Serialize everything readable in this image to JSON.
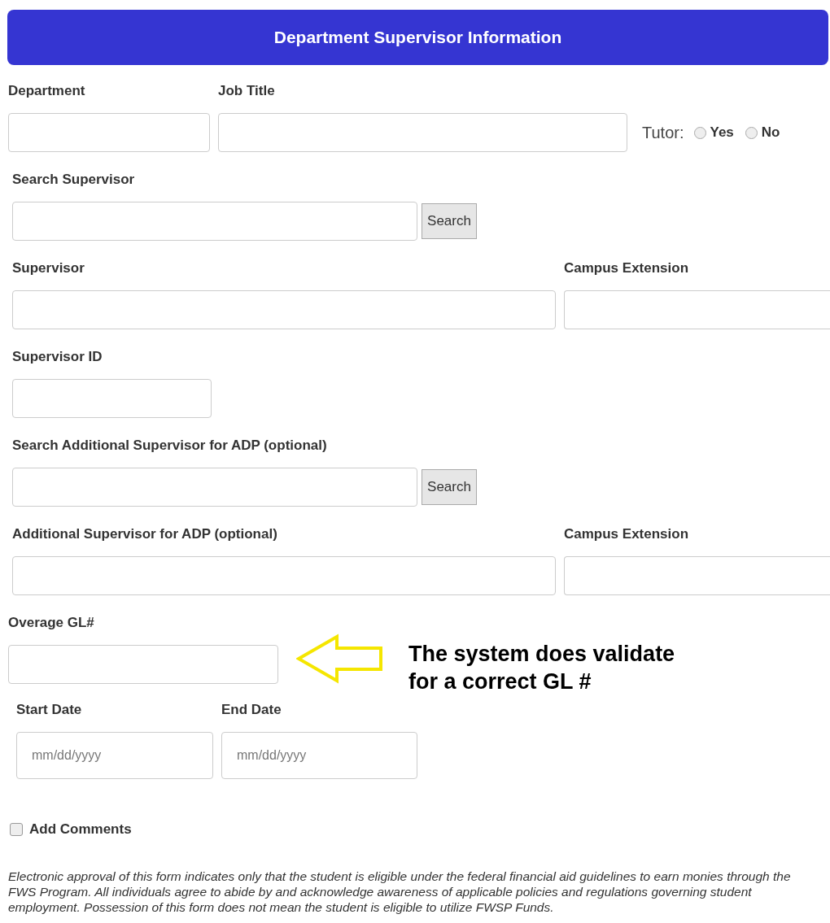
{
  "header": {
    "title": "Department Supervisor Information"
  },
  "department": {
    "label": "Department"
  },
  "job_title": {
    "label": "Job Title"
  },
  "tutor": {
    "label": "Tutor:",
    "options": [
      {
        "label": "Yes",
        "selected": false
      },
      {
        "label": "No",
        "selected": false
      }
    ]
  },
  "search_supervisor": {
    "label": "Search Supervisor",
    "button": "Search"
  },
  "supervisor": {
    "label": "Supervisor"
  },
  "campus_extension": {
    "label": "Campus Extension"
  },
  "supervisor_id": {
    "label": "Supervisor ID"
  },
  "search_additional": {
    "label": "Search Additional Supervisor for ADP (optional)",
    "button": "Search"
  },
  "additional_supervisor": {
    "label": "Additional Supervisor for ADP (optional)"
  },
  "campus_extension_2": {
    "label": "Campus Extension"
  },
  "overage_gl": {
    "label": "Overage GL#"
  },
  "annotation": {
    "lines": [
      "The system does validate",
      "for a correct GL #"
    ]
  },
  "start_date": {
    "label": "Start Date",
    "placeholder": "mm/dd/yyyy"
  },
  "end_date": {
    "label": "End Date",
    "placeholder": "mm/dd/yyyy"
  },
  "add_comments": {
    "label": "Add Comments",
    "checked": false
  },
  "disclaimer": "Electronic approval of this form indicates only that the student is eligible under the federal financial aid guidelines to earn monies through the FWS Program. All individuals agree to abide by and acknowledge awareness of applicable policies and regulations governing student employment. Possession of this form does not mean the student is eligible to utilize FWSP Funds."
}
